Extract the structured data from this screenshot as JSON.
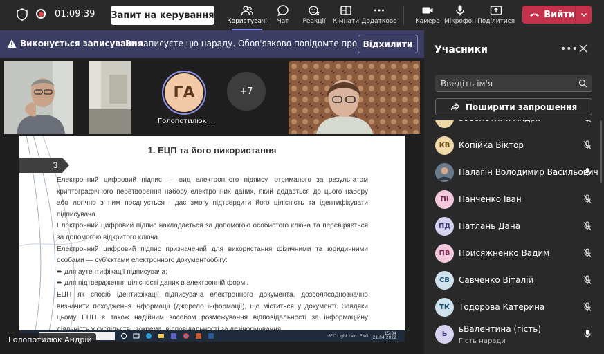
{
  "topbar": {
    "timer": "01:09:39",
    "request_control": "Запит на керування",
    "tools": [
      {
        "label": "Користувачі",
        "icon": "people-icon"
      },
      {
        "label": "Чат",
        "icon": "chat-icon"
      },
      {
        "label": "Реакції",
        "icon": "reactions-icon"
      },
      {
        "label": "Кімнати",
        "icon": "rooms-icon"
      },
      {
        "label": "Додатково",
        "icon": "more-icon"
      },
      {
        "label": "Камера",
        "icon": "camera-icon"
      },
      {
        "label": "Мікрофон",
        "icon": "microphone-icon"
      },
      {
        "label": "Поділитися",
        "icon": "share-icon"
      }
    ],
    "leave": "Вийти"
  },
  "banner": {
    "title": "Виконується записування",
    "text": "Ви записуєте цю нараду. Обов'язково повідомте про запис...",
    "dismiss": "Відхилити"
  },
  "stage": {
    "avatar_initials": "ГА",
    "avatar_name": "Голопотилюк ...",
    "more_count": "+7",
    "speaker_name": "Голопотилюк Андрій"
  },
  "slide": {
    "title": "1. ЕЦП та його використання",
    "number": "3",
    "paragraphs": [
      "Електронний цифровий підпис — вид електронного підпису, отриманого за результатом криптографічного перетворення набору електронних даних, який додається до цього набору або логічно з ним поєднується і дає змогу підтвердити його цілісність та ідентифікувати підписувача.",
      "Електронний цифровий підпис накладається за допомогою особистого ключа та перевіряється за допомогою відкритого ключа.",
      "Електронний цифровий підпис призначений для використання фізичними та юридичними особами — суб'єктами електронного документообігу:"
    ],
    "bullets": [
      "для аутентифікації підписувача;",
      "для підтвердження цілісності даних в електронній формі."
    ],
    "closing": "ЕЦП як спосіб ідентифікації підписувача електронного документа, дозволяєоднозначно визначити походження інформації (джерело інформації), що міститься у документі. Завдяки цьому ЕЦП є також надійним засобом розмежування відповідальності за інформаційну діяльність у суспільстві, зокрема, відповідальності за дезінормування",
    "taskbar": {
      "search": "Введіть запит тут",
      "weather": "6°C Light rain",
      "lang": "ENG",
      "time": "15:34",
      "date": "21.04.2022"
    }
  },
  "panel": {
    "title": "Учасники",
    "search_placeholder": "Введіть ім'я",
    "share": "Поширити запрошення",
    "participants": [
      {
        "initials": "",
        "name": "Заболотний Андрій",
        "sub": "",
        "mic": "muted",
        "color": "#f0d9a8",
        "fg": "#6b4d12"
      },
      {
        "initials": "КВ",
        "name": "Копійка Віктор",
        "sub": "",
        "mic": "muted",
        "color": "#f0d9a8",
        "fg": "#6b4d12"
      },
      {
        "initials": "",
        "name": "Палагін Володимир Васильович",
        "sub": "",
        "mic": "on",
        "color": "#6b7a8a",
        "fg": "#ffffff"
      },
      {
        "initials": "ПІ",
        "name": "Панченко Іван",
        "sub": "",
        "mic": "muted",
        "color": "#f4c9dd",
        "fg": "#7a2952"
      },
      {
        "initials": "ПД",
        "name": "Патлань Дана",
        "sub": "",
        "mic": "muted",
        "color": "#d6d3f0",
        "fg": "#3d3a7a"
      },
      {
        "initials": "ПВ",
        "name": "Присяжненко Вадим",
        "sub": "",
        "mic": "muted",
        "color": "#f4c9dd",
        "fg": "#7a2952"
      },
      {
        "initials": "СВ",
        "name": "Савченко Віталій",
        "sub": "",
        "mic": "muted",
        "color": "#cfe3ef",
        "fg": "#1d4f6e"
      },
      {
        "initials": "ТК",
        "name": "Тодорова Катерина",
        "sub": "",
        "mic": "muted",
        "color": "#cfe3ef",
        "fg": "#1d4f6e"
      },
      {
        "initials": "Ь",
        "name": "ьВалентина (гість)",
        "sub": "Гість наради",
        "mic": "on",
        "color": "#d6d3f0",
        "fg": "#3d3a7a"
      }
    ]
  },
  "colors": {
    "accent": "#7f85f5",
    "leave": "#c4314b",
    "banner": "#3b3d63"
  }
}
